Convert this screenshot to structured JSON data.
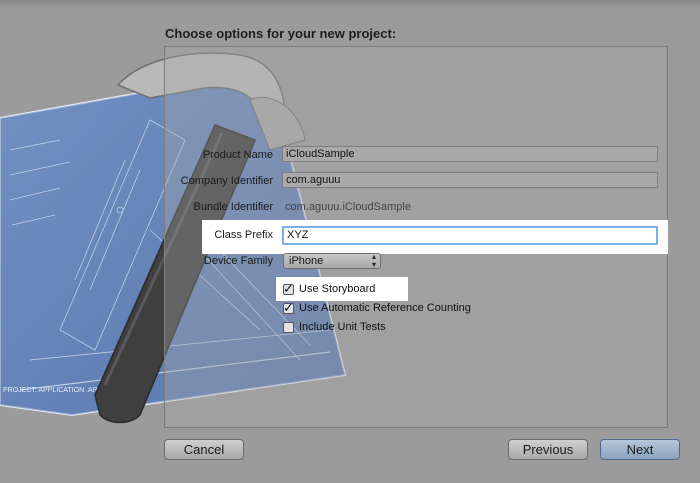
{
  "dialog": {
    "title": "Choose options for your new project:"
  },
  "form": {
    "product_name": {
      "label": "Product Name",
      "value": "iCloudSample"
    },
    "company_identifier": {
      "label": "Company Identifier",
      "value": "com.aguuu"
    },
    "bundle_identifier": {
      "label": "Bundle Identifier",
      "value": "com.aguuu.iCloudSample"
    },
    "class_prefix": {
      "label": "Class Prefix",
      "value": "XYZ"
    },
    "device_family": {
      "label": "Device Family",
      "value": "iPhone"
    }
  },
  "options": [
    {
      "label": "Use Storyboard",
      "checked": true
    },
    {
      "label": "Use Automatic Reference Counting",
      "checked": true
    },
    {
      "label": "Include Unit Tests",
      "checked": false
    }
  ],
  "background": {
    "blueprint_caption": "PROJECT: APPLICATION .APP"
  },
  "buttons": {
    "cancel": "Cancel",
    "previous": "Previous",
    "next": "Next"
  },
  "colors": {
    "dim_background": "#9a9a9a",
    "blueprint": "#5e80b8",
    "focus_ring": "#79b0ea",
    "primary_button": "#8aa2bd"
  }
}
